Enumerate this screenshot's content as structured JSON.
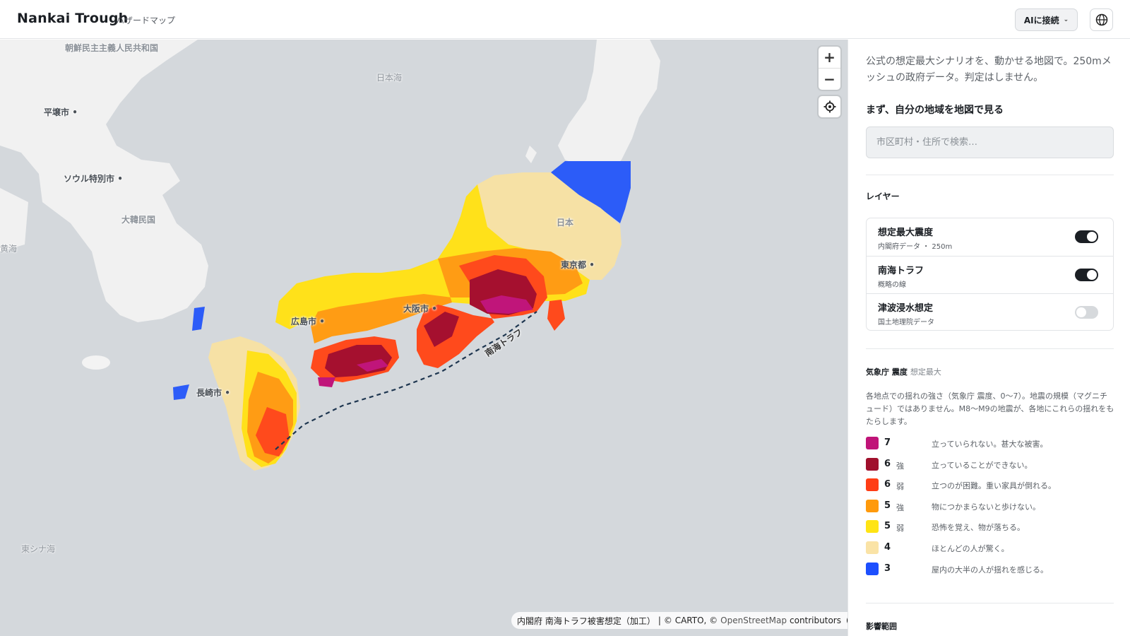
{
  "header": {
    "title": "Nankai Trough",
    "subtitle": "ハザードマップ",
    "ai_button_label": "AIに接続",
    "ai_button_icon": "chevron-down-icon",
    "language_icon": "globe-icon"
  },
  "map": {
    "labels": {
      "north_korea": "朝鮮民主主義人民共和国",
      "sea_of_japan": "日本海",
      "pyongyang": "平壌市",
      "seoul": "ソウル特別市",
      "south_korea": "大韓民国",
      "yellow_sea": "黄海",
      "japan": "日本",
      "tokyo": "東京都",
      "osaka": "大阪市",
      "hiroshima": "広島市",
      "nagasaki": "長崎市",
      "east_china_sea": "東シナ海",
      "nankai_trough": "南海トラフ"
    },
    "controls": {
      "zoom_in": "+",
      "zoom_out": "−"
    },
    "attribution": {
      "source": "内閣府 南海トラフ被害想定（加工）",
      "separator": "|",
      "carto": "© CARTO, ©",
      "osm": "OpenStreetMap",
      "contributors": "contributors",
      "info": "i"
    }
  },
  "panel": {
    "intro": "公式の想定最大シナリオを、動かせる地図で。250mメッシュの政府データ。判定はしません。",
    "search_heading": "まず、自分の地域を地図で見る",
    "search_placeholder": "市区町村・住所で検索…",
    "layers_heading": "レイヤー",
    "layers": [
      {
        "name": "想定最大震度",
        "sub": "内閣府データ ・ 250m",
        "enabled": true
      },
      {
        "name": "南海トラフ",
        "sub": "概略の線",
        "enabled": true
      },
      {
        "name": "津波浸水想定",
        "sub": "国土地理院データ",
        "enabled": false
      }
    ],
    "legend_heading": "気象庁 震度",
    "legend_heading_muted": "想定最大",
    "legend_description": "各地点での揺れの強さ（気象庁 震度、0〜7）。地震の規模（マグニチュード）ではありません。M8〜M9の地震が、各地にこれらの揺れをもたらします。",
    "legend": [
      {
        "level": "7",
        "mod": "",
        "text": "立っていられない。甚大な被害。",
        "color": "#c01478"
      },
      {
        "level": "6",
        "mod": "強",
        "text": "立っていることができない。",
        "color": "#a0102c"
      },
      {
        "level": "6",
        "mod": "弱",
        "text": "立つのが困難。重い家具が倒れる。",
        "color": "#ff3d15"
      },
      {
        "level": "5",
        "mod": "強",
        "text": "物につかまらないと歩けない。",
        "color": "#ff9a0c"
      },
      {
        "level": "5",
        "mod": "弱",
        "text": "恐怖を覚え、物が落ちる。",
        "color": "#ffe414"
      },
      {
        "level": "4",
        "mod": "",
        "text": "ほとんどの人が驚く。",
        "color": "#fae3a6"
      },
      {
        "level": "3",
        "mod": "",
        "text": "屋内の大半の人が揺れを感じる。",
        "color": "#1d4ffe"
      }
    ],
    "impact_heading": "影響範囲"
  }
}
